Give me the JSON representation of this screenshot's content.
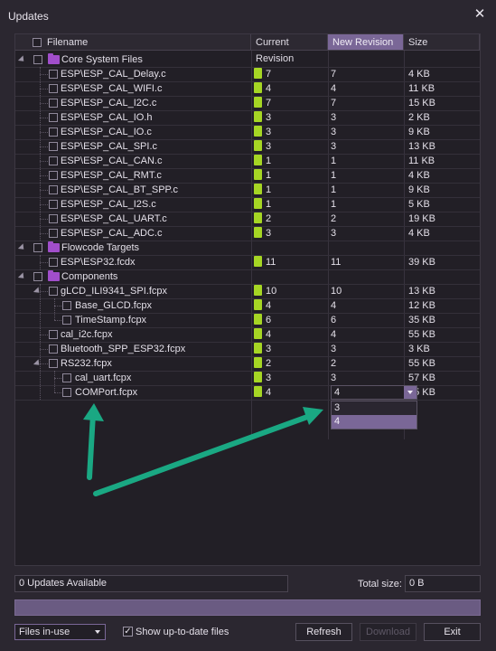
{
  "window": {
    "title": "Updates",
    "close_glyph": "✕"
  },
  "columns": [
    "Filename",
    "Current Revision",
    "New Revision",
    "Size"
  ],
  "sections": [
    {
      "name": "Core System Files",
      "items": [
        {
          "name": "ESP\\ESP_CAL_Delay.c",
          "current": "7",
          "new": "7",
          "size": "4 KB"
        },
        {
          "name": "ESP\\ESP_CAL_WIFI.c",
          "current": "4",
          "new": "4",
          "size": "11 KB"
        },
        {
          "name": "ESP\\ESP_CAL_I2C.c",
          "current": "7",
          "new": "7",
          "size": "15 KB"
        },
        {
          "name": "ESP\\ESP_CAL_IO.h",
          "current": "3",
          "new": "3",
          "size": "2 KB"
        },
        {
          "name": "ESP\\ESP_CAL_IO.c",
          "current": "3",
          "new": "3",
          "size": "9 KB"
        },
        {
          "name": "ESP\\ESP_CAL_SPI.c",
          "current": "3",
          "new": "3",
          "size": "13 KB"
        },
        {
          "name": "ESP\\ESP_CAL_CAN.c",
          "current": "1",
          "new": "1",
          "size": "11 KB"
        },
        {
          "name": "ESP\\ESP_CAL_RMT.c",
          "current": "1",
          "new": "1",
          "size": "4 KB"
        },
        {
          "name": "ESP\\ESP_CAL_BT_SPP.c",
          "current": "1",
          "new": "1",
          "size": "9 KB"
        },
        {
          "name": "ESP\\ESP_CAL_I2S.c",
          "current": "1",
          "new": "1",
          "size": "5 KB"
        },
        {
          "name": "ESP\\ESP_CAL_UART.c",
          "current": "2",
          "new": "2",
          "size": "19 KB"
        },
        {
          "name": "ESP\\ESP_CAL_ADC.c",
          "current": "3",
          "new": "3",
          "size": "4 KB"
        }
      ]
    },
    {
      "name": "Flowcode Targets",
      "items": [
        {
          "name": "ESP\\ESP32.fcdx",
          "current": "11",
          "new": "11",
          "size": "39 KB"
        }
      ]
    },
    {
      "name": "Components",
      "items": [
        {
          "name": "gLCD_ILI9341_SPI.fcpx",
          "current": "10",
          "new": "10",
          "size": "13 KB",
          "level": 1,
          "expandable": true
        },
        {
          "name": "Base_GLCD.fcpx",
          "current": "4",
          "new": "4",
          "size": "12 KB",
          "level": 2
        },
        {
          "name": "TimeStamp.fcpx",
          "current": "6",
          "new": "6",
          "size": "35 KB",
          "level": 2
        },
        {
          "name": "cal_i2c.fcpx",
          "current": "4",
          "new": "4",
          "size": "55 KB",
          "level": 1
        },
        {
          "name": "Bluetooth_SPP_ESP32.fcpx",
          "current": "3",
          "new": "3",
          "size": "3 KB",
          "level": 1
        },
        {
          "name": "RS232.fcpx",
          "current": "2",
          "new": "2",
          "size": "55 KB",
          "level": 1,
          "expandable": true
        },
        {
          "name": "cal_uart.fcpx",
          "current": "3",
          "new": "3",
          "size": "57 KB",
          "level": 2
        },
        {
          "name": "COMPort.fcpx",
          "current": "4",
          "new": "4",
          "size": "55 KB",
          "level": 2,
          "combo": true
        }
      ]
    }
  ],
  "dropdown_options": [
    "3",
    "4"
  ],
  "dropdown_selected": "4",
  "status": {
    "updates_text": "0 Updates Available",
    "total_label": "Total size:",
    "total_value": "0 B",
    "progress": 0
  },
  "footer": {
    "filter_value": "Files in-use",
    "show_uptodate_label": "Show up-to-date files",
    "show_uptodate_checked": true,
    "check_glyph": "✓",
    "refresh": "Refresh",
    "download": "Download",
    "exit": "Exit"
  },
  "colors": {
    "accent": "#7a6797",
    "revision_badge": "#a6d624",
    "folder": "#a14ecb",
    "annotation_arrow": "#1aa883",
    "background": "#2b2730"
  }
}
